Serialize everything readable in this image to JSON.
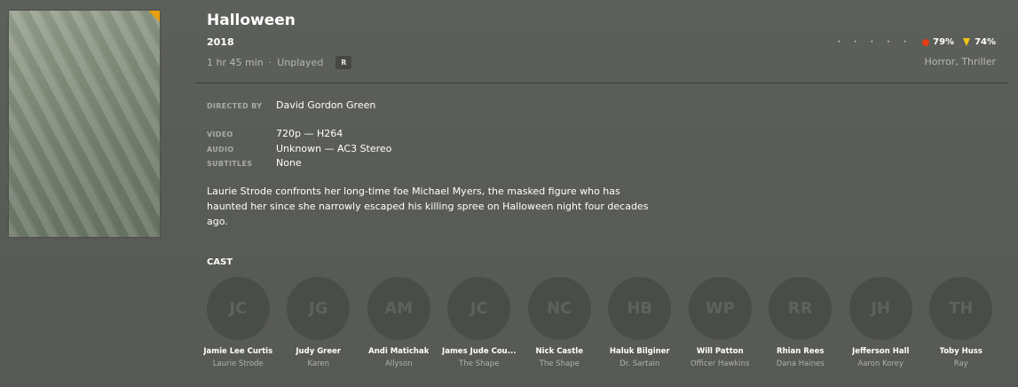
{
  "movie": {
    "title": "Halloween",
    "year": "2018",
    "duration": "1 hr 45 min",
    "separator": "·",
    "status": "Unplayed",
    "rating_badge": "R",
    "critic_rating": "79%",
    "audience_rating": "74%",
    "dots": "· · · · ·",
    "genres": "Horror, Thriller"
  },
  "details": {
    "directed_by_label": "DIRECTED BY",
    "directed_by": "David Gordon Green",
    "video_label": "VIDEO",
    "video": "720p — H264",
    "audio_label": "AUDIO",
    "audio": "Unknown — AC3 Stereo",
    "subtitles_label": "SUBTITLES",
    "subtitles": "None"
  },
  "summary": "Laurie Strode confronts her long-time foe Michael Myers, the masked figure who has haunted her since she narrowly escaped his killing spree on Halloween night four decades ago.",
  "cast_heading": "CAST",
  "cast": [
    {
      "initials": "JC",
      "name": "Jamie Lee Curtis",
      "role": "Laurie Strode"
    },
    {
      "initials": "JG",
      "name": "Judy Greer",
      "role": "Karen"
    },
    {
      "initials": "AM",
      "name": "Andi Matichak",
      "role": "Allyson"
    },
    {
      "initials": "JC",
      "name": "James Jude Cou...",
      "role": "The Shape"
    },
    {
      "initials": "NC",
      "name": "Nick Castle",
      "role": "The Shape"
    },
    {
      "initials": "HB",
      "name": "Haluk Bilginer",
      "role": "Dr. Sartain"
    },
    {
      "initials": "WP",
      "name": "Will Patton",
      "role": "Officer Hawkins"
    },
    {
      "initials": "RR",
      "name": "Rhian Rees",
      "role": "Dana Haines"
    },
    {
      "initials": "JH",
      "name": "Jefferson Hall",
      "role": "Aaron Korey"
    },
    {
      "initials": "TH",
      "name": "Toby Huss",
      "role": "Ray"
    }
  ],
  "colors": {
    "accent": "#e5a00d",
    "tomato": "#e23d14",
    "popcorn": "#f5c518"
  }
}
